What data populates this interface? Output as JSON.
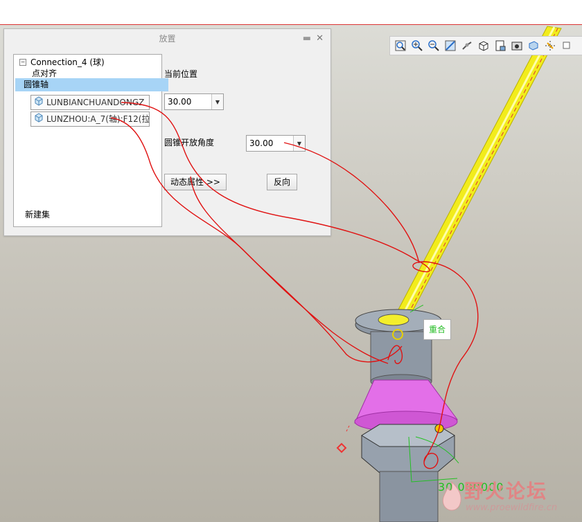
{
  "panel": {
    "title": "放置",
    "tree": {
      "connection": "Connection_4 (球)",
      "constraint_point": "点对齐",
      "constraint_cone": "圆锥轴",
      "ref1": "LUNBIANCHUANDONGZ",
      "ref2": "LUNZHOU:A_7(轴):F12(拉",
      "new_set": "新建集"
    },
    "current_position_label": "当前位置",
    "current_position_value": "30.00",
    "cone_angle_label": "圆锥开放角度",
    "cone_angle_value": "30.00",
    "dynamic_props_button": "动态属性 >>",
    "flip_button": "反向"
  },
  "viewport": {
    "badge": "重合",
    "dimension": "30.000000"
  },
  "watermark": {
    "title": "野火论坛",
    "url": "www.proewildfire.cn"
  },
  "colors": {
    "shaft": "#ffff33",
    "cone": "#e060e0",
    "annotation": "#ee1111",
    "highlight": "#22c022"
  }
}
